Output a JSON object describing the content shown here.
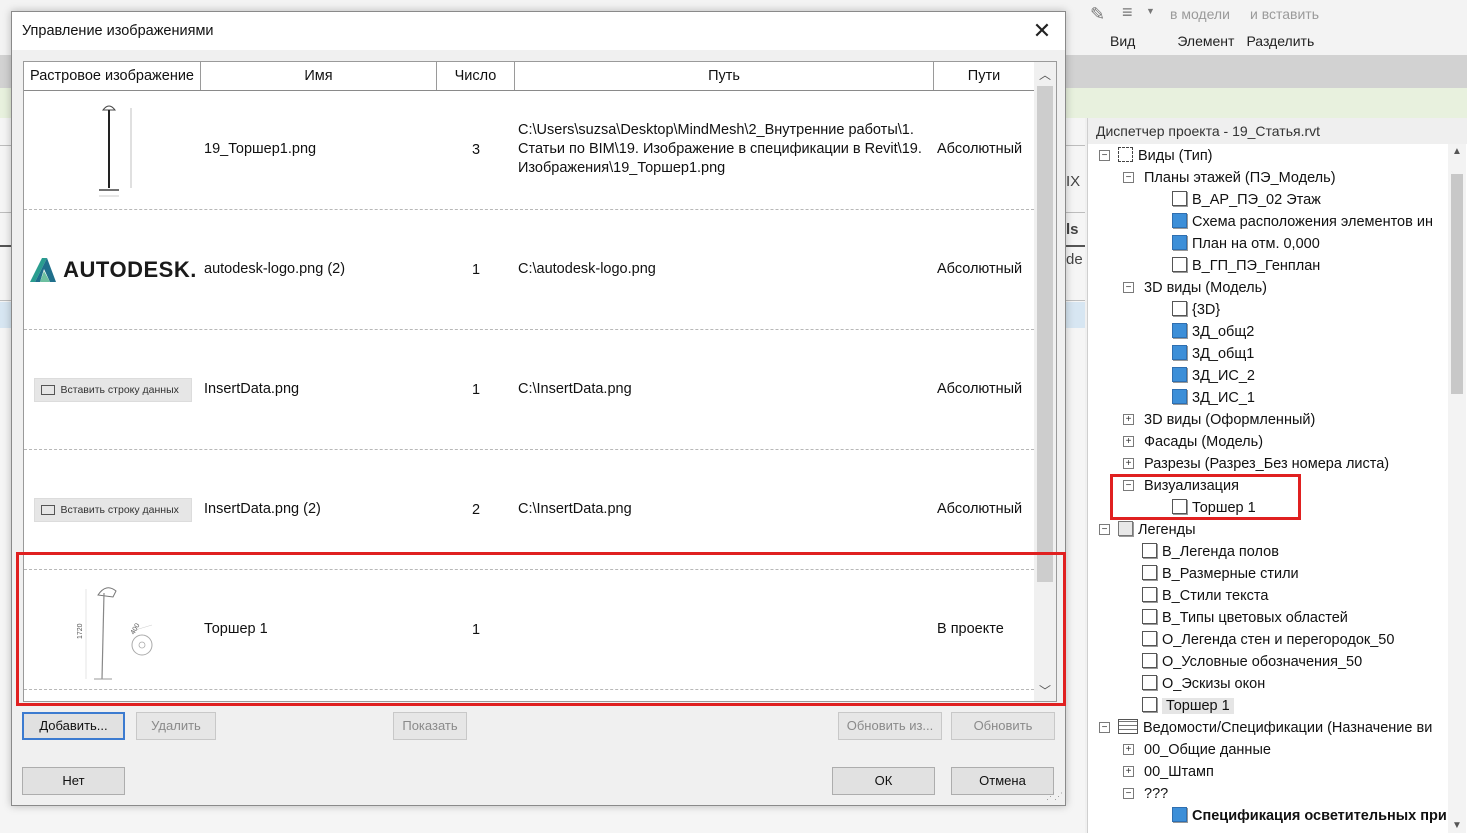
{
  "ribbon": {
    "ghost_items": [
      "в модели",
      "и вставить"
    ],
    "panel_labels": [
      "Вид",
      "Элемент",
      "Разделить"
    ]
  },
  "background_peek": [
    "IX",
    "ls",
    "de"
  ],
  "project_browser": {
    "title": "Диспетчер проекта - 19_Статья.rvt",
    "rows": [
      {
        "label": "Виды (Тип)",
        "level": 0,
        "toggle": "minus",
        "icon": "views"
      },
      {
        "label": "Планы этажей (ПЭ_Модель)",
        "level": 1,
        "toggle": "minus"
      },
      {
        "label": "В_АР_ПЭ_02 Этаж",
        "level": 2,
        "icon": "white"
      },
      {
        "label": "Схема расположения элементов ин",
        "level": 2,
        "icon": "blue"
      },
      {
        "label": "План на отм. 0,000",
        "level": 2,
        "icon": "blue"
      },
      {
        "label": "В_ГП_ПЭ_Генплан",
        "level": 2,
        "icon": "white"
      },
      {
        "label": "3D виды (Модель)",
        "level": 1,
        "toggle": "minus"
      },
      {
        "label": "{3D}",
        "level": 2,
        "icon": "white"
      },
      {
        "label": "3Д_общ2",
        "level": 2,
        "icon": "blue"
      },
      {
        "label": "3Д_общ1",
        "level": 2,
        "icon": "blue"
      },
      {
        "label": "3Д_ИС_2",
        "level": 2,
        "icon": "blue"
      },
      {
        "label": "3Д_ИС_1",
        "level": 2,
        "icon": "blue"
      },
      {
        "label": "3D виды (Оформленный)",
        "level": 1,
        "toggle": "plus"
      },
      {
        "label": "Фасады (Модель)",
        "level": 1,
        "toggle": "plus"
      },
      {
        "label": "Разрезы (Разрез_Без номера листа)",
        "level": 1,
        "toggle": "plus"
      },
      {
        "label": "Визуализация",
        "level": 1,
        "toggle": "minus"
      },
      {
        "label": "Торшер 1",
        "level": 2,
        "icon": "white"
      },
      {
        "label": "Легенды",
        "level": 0,
        "toggle": "minus",
        "icon": "legend"
      },
      {
        "label": "В_Легенда полов",
        "level": 1,
        "icon": "white"
      },
      {
        "label": "В_Размерные стили",
        "level": 1,
        "icon": "white"
      },
      {
        "label": "В_Стили текста",
        "level": 1,
        "icon": "white"
      },
      {
        "label": "В_Типы цветовых областей",
        "level": 1,
        "icon": "white"
      },
      {
        "label": "О_Легенда стен и перегородок_50",
        "level": 1,
        "icon": "white"
      },
      {
        "label": "О_Условные обозначения_50",
        "level": 1,
        "icon": "white"
      },
      {
        "label": "О_Эскизы окон",
        "level": 1,
        "icon": "white"
      },
      {
        "label": "Торшер 1",
        "level": 1,
        "icon": "white",
        "selected": true
      },
      {
        "label": "Ведомости/Спецификации (Назначение ви",
        "level": 0,
        "toggle": "minus",
        "icon": "table"
      },
      {
        "label": "00_Общие данные",
        "level": 1,
        "toggle": "plus"
      },
      {
        "label": "00_Штамп",
        "level": 1,
        "toggle": "plus"
      },
      {
        "label": "???",
        "level": 1,
        "toggle": "minus"
      },
      {
        "label": "Спецификация осветительных при",
        "level": 2,
        "icon": "blue",
        "bold": true
      }
    ]
  },
  "dialog": {
    "title": "Управление изображениями",
    "columns": [
      "Растровое изображение",
      "Имя",
      "Число",
      "Путь",
      "Пути"
    ],
    "rows": [
      {
        "thumb": "lamp-drawing",
        "name": "19_Торшер1.png",
        "count": "3",
        "path": "C:\\Users\\suzsa\\Desktop\\MindMesh\\2_Внутренние работы\\1. Статьи по BIM\\19. Изображение в спецификации в Revit\\19. Изображения\\19_Торшер1.png",
        "paths": "Абсолютный"
      },
      {
        "thumb": "autodesk-logo",
        "thumb_text": "AUTODESK.",
        "name": "autodesk-logo.png (2)",
        "count": "1",
        "path": "C:\\autodesk-logo.png",
        "paths": "Абсолютный"
      },
      {
        "thumb": "insert-data",
        "thumb_text": "Вставить строку данных",
        "name": "InsertData.png",
        "count": "1",
        "path": "C:\\InsertData.png",
        "paths": "Абсолютный"
      },
      {
        "thumb": "insert-data",
        "thumb_text": "Вставить строку данных",
        "name": "InsertData.png (2)",
        "count": "2",
        "path": "C:\\InsertData.png",
        "paths": "Абсолютный"
      },
      {
        "thumb": "lamp-render",
        "thumb_text": [
          "1720",
          "400"
        ],
        "name": "Торшер 1",
        "count": "1",
        "path": "",
        "paths": "В проекте"
      }
    ],
    "buttons": {
      "add": "Добавить...",
      "delete": "Удалить",
      "show": "Показать",
      "reload_from": "Обновить из...",
      "reload": "Обновить",
      "no": "Нет",
      "ok": "ОК",
      "cancel": "Отмена"
    },
    "close_glyph": "✕"
  },
  "colors": {
    "highlight": "#e02020",
    "view_blue": "#3d8fd8",
    "ribbon_green": "#e8f1de",
    "default_button_border": "#3c7bd0"
  }
}
